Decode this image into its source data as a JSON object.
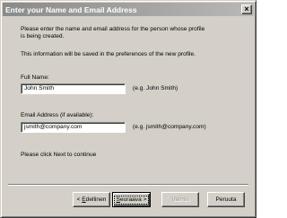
{
  "window": {
    "title": "Enter your Name and Email Address",
    "close_glyph": "×",
    "title_gradient": [
      "#8a8a8a",
      "#b8b8b8"
    ],
    "background": "#d4d0c8"
  },
  "content": {
    "intro_line1": "Please enter the name and email address for the person whose profile",
    "intro_line2": "is being created.",
    "info": "This information will be saved in the preferences of the new profile.",
    "fullname_label": "Full Name:",
    "fullname_value": "John Smith",
    "fullname_hint": "(e.g. John Smith)",
    "email_label": "Email Address (if available):",
    "email_value": "jsmith@company.com",
    "email_hint": "(e.g. jsmith@company.com)",
    "continue_note": "Please click Next to continue"
  },
  "buttons": {
    "back_prefix": "< ",
    "back_accel": "E",
    "back_rest": "dellinen",
    "next_accel": "S",
    "next_rest": "euraava",
    "next_suffix": " >",
    "finish_label": "Valmis",
    "cancel_label": "Peruuta"
  },
  "icons": {
    "close": "close-icon"
  }
}
